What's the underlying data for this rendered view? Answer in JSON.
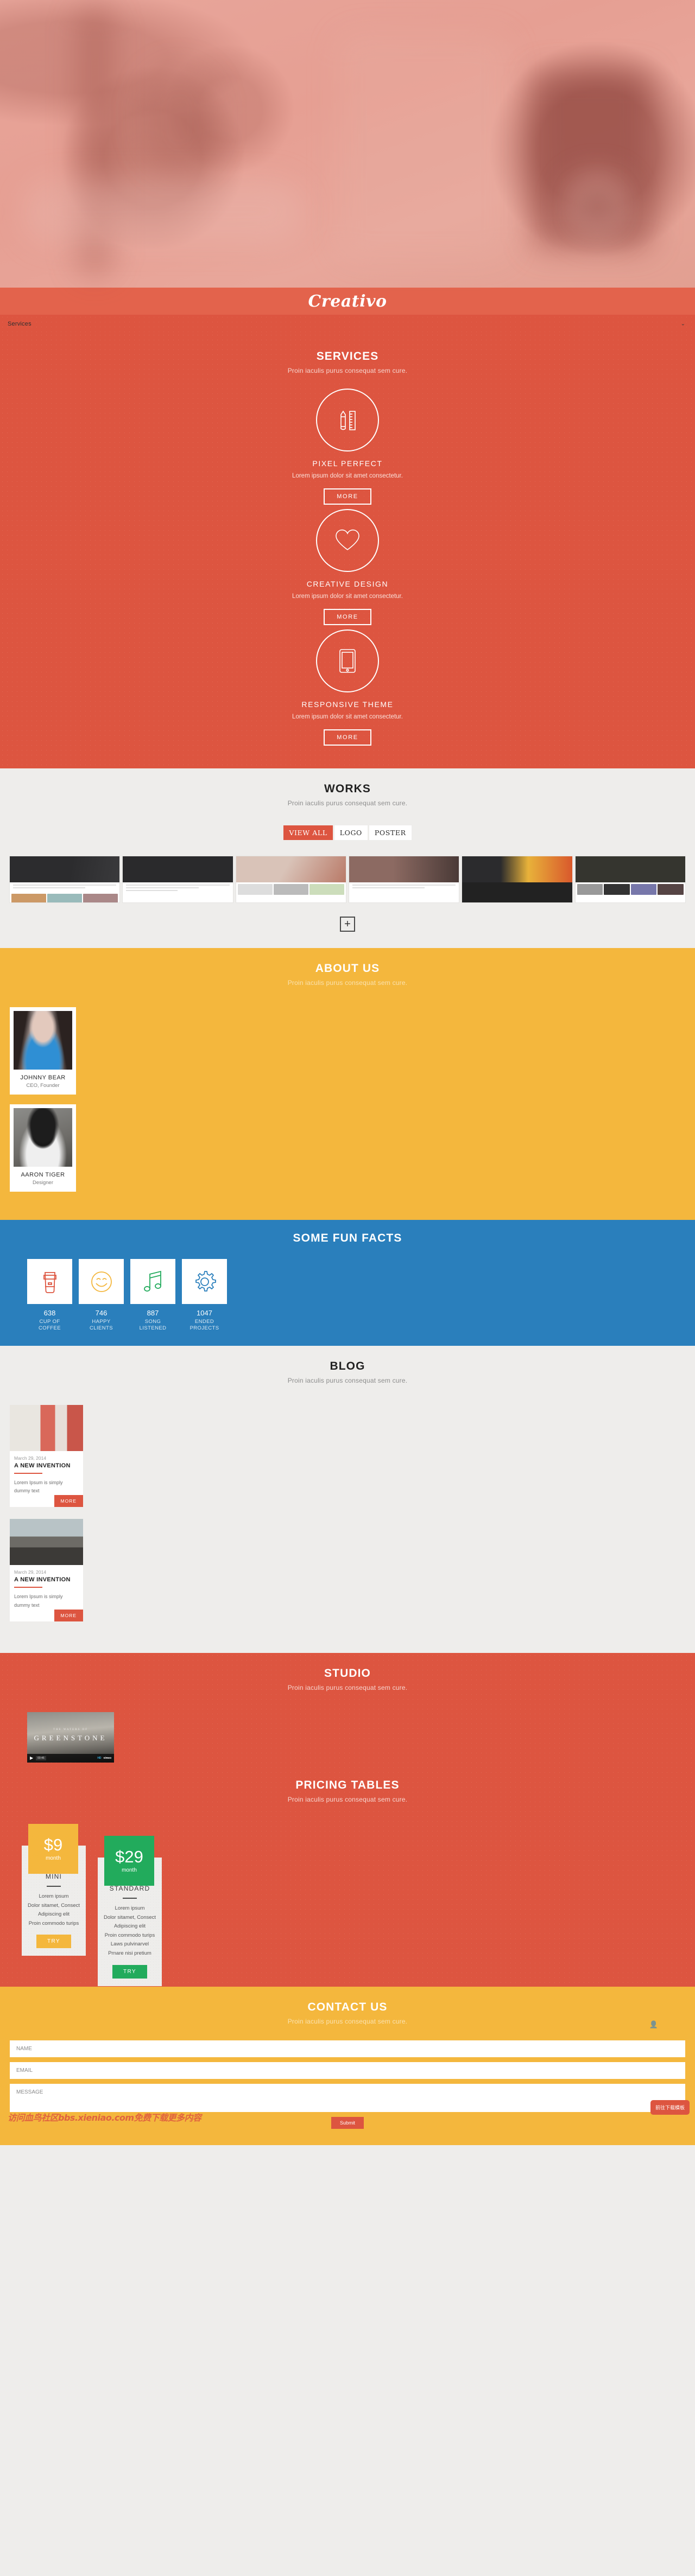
{
  "brand": {
    "name": "Creativo"
  },
  "nav": {
    "items": [
      "Services"
    ],
    "caret": "⌄"
  },
  "sections": {
    "services": {
      "title": "SERVICES",
      "subtitle": "Proin iaculis purus consequat sem cure.",
      "items": [
        {
          "icon": "pencil-ruler-icon",
          "name": "PIXEL PERFECT",
          "desc": "Lorem ipsum dolor sit amet consectetur.",
          "button": "MORE"
        },
        {
          "icon": "heart-icon",
          "name": "CREATIVE DESIGN",
          "desc": "Lorem ipsum dolor sit amet consectetur.",
          "button": "MORE"
        },
        {
          "icon": "tablet-icon",
          "name": "RESPONSIVE THEME",
          "desc": "Lorem ipsum dolor sit amet consectetur.",
          "button": "MORE"
        }
      ]
    },
    "works": {
      "title": "WORKS",
      "subtitle": "Proin iaculis purus consequat sem cure.",
      "filters": [
        {
          "label": "VIEW ALL",
          "active": true
        },
        {
          "label": "LOGO",
          "active": false
        },
        {
          "label": "POSTER",
          "active": false
        }
      ],
      "load_more": "+"
    },
    "about": {
      "title": "ABOUT US",
      "subtitle": "Proin iaculis purus consequat sem cure.",
      "members": [
        {
          "name": "JOHNNY BEAR",
          "role": "CEO, Founder"
        },
        {
          "name": "AARON TIGER",
          "role": "Designer"
        }
      ]
    },
    "facts": {
      "title": "SOME FUN FACTS",
      "items": [
        {
          "icon": "coffee-cup-icon",
          "value": "638",
          "label": "CUP OF\nCOFFEE"
        },
        {
          "icon": "smiley-face-icon",
          "value": "746",
          "label": "HAPPY\nCLIENTS"
        },
        {
          "icon": "music-note-icon",
          "value": "887",
          "label": "SONG\nLISTENED"
        },
        {
          "icon": "gear-icon",
          "value": "1047",
          "label": "ENDED\nPROJECTS"
        }
      ]
    },
    "blog": {
      "title": "BLOG",
      "subtitle": "Proin iaculis purus consequat sem cure.",
      "posts": [
        {
          "date": "March 29, 2014",
          "title": "A NEW INVENTION",
          "excerpt": "Lorem Ipsum is simply dummy text",
          "button": "MORE"
        },
        {
          "date": "March 29, 2014",
          "title": "A NEW INVENTION",
          "excerpt": "Lorem Ipsum is simply dummy text",
          "button": "MORE"
        }
      ]
    },
    "studio": {
      "title": "STUDIO",
      "subtitle": "Proin iaculis purus consequat sem cure.",
      "video": {
        "overline": "THE WATERS OF",
        "title": "GREENSTONE",
        "time": "00:46",
        "quality": "HD",
        "provider": "vimeo"
      }
    },
    "pricing": {
      "title": "PRICING TABLES",
      "subtitle": "Proin iaculis purus consequat sem cure.",
      "plans": [
        {
          "price": "$9",
          "per": "month",
          "name": "MINI",
          "features": [
            "Lorem ipsum",
            "Dolor sitamet, Consect",
            "Adipiscing elit",
            "Proin commodo turips"
          ],
          "button": "TRY",
          "color": "#f4b73d"
        },
        {
          "price": "$29",
          "per": "month",
          "name": "STANDARD",
          "features": [
            "Lorem ipsum",
            "Dolor sitamet, Consect",
            "Adipiscing elit",
            "Proin commodo turips",
            "Laws pulvinarvel",
            "Prnare nisi pretium"
          ],
          "button": "TRY",
          "color": "#22ab5c"
        }
      ]
    },
    "contact": {
      "title": "CONTACT US",
      "subtitle": "Proin iaculis purus consequat sem cure.",
      "fields": [
        {
          "name": "name-field",
          "placeholder": "NAME",
          "icon": "person-icon"
        },
        {
          "name": "email-field",
          "placeholder": "EMAIL",
          "icon": "at-icon"
        },
        {
          "name": "message-field",
          "placeholder": "MESSAGE",
          "icon": "pencil-icon"
        }
      ],
      "submit": "Submit"
    }
  },
  "overlay": {
    "watermark": "访问血鸟社区bbs.xieniao.com免费下载更多内容",
    "download_button": "前往下载模板"
  },
  "colors": {
    "primary_red": "#dd5540",
    "yellow": "#f4b73d",
    "blue": "#2a7fbc",
    "green": "#22ab5c",
    "light_gray": "#eeedeb"
  }
}
